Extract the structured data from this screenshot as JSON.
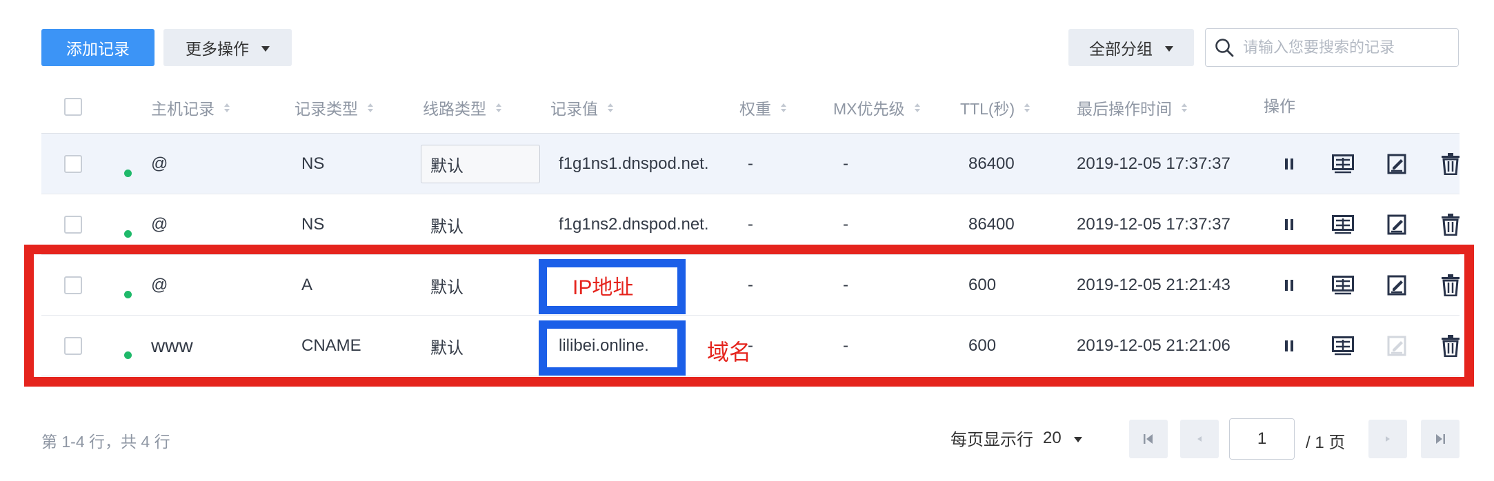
{
  "toolbar": {
    "add_label": "添加记录",
    "more_label": "更多操作",
    "group_label": "全部分组",
    "search_placeholder": "请输入您要搜索的记录"
  },
  "table": {
    "headers": {
      "host": "主机记录",
      "type": "记录类型",
      "route": "线路类型",
      "value": "记录值",
      "weight": "权重",
      "mx": "MX优先级",
      "ttl": "TTL(秒)",
      "time": "最后操作时间",
      "ops": "操作"
    },
    "rows": [
      {
        "host": "@",
        "type": "NS",
        "route": "默认",
        "value": "f1g1ns1.dnspod.net.",
        "weight": "-",
        "mx": "-",
        "ttl": "86400",
        "time": "2019-12-05 17:37:37"
      },
      {
        "host": "@",
        "type": "NS",
        "route": "默认",
        "value": "f1g1ns2.dnspod.net.",
        "weight": "-",
        "mx": "-",
        "ttl": "86400",
        "time": "2019-12-05 17:37:37"
      },
      {
        "host": "@",
        "type": "A",
        "route": "默认",
        "value": "IP地址",
        "weight": "-",
        "mx": "-",
        "ttl": "600",
        "time": "2019-12-05 21:21:43"
      },
      {
        "host": "www",
        "type": "CNAME",
        "route": "默认",
        "value": "lilibei.online.",
        "weight": "-",
        "mx": "-",
        "ttl": "600",
        "time": "2019-12-05 21:21:06"
      }
    ]
  },
  "annotations": {
    "domain_label": "域名"
  },
  "pagination": {
    "summary": "第 1-4 行，共 4 行",
    "per_page_label": "每页显示行",
    "per_page_value": "20",
    "current_page": "1",
    "total_pages": "/ 1 页"
  },
  "colors": {
    "primary": "#3c94f6",
    "status_enabled": "#1fb96a",
    "annotation_red": "#e5241d",
    "annotation_blue": "#1b5fe8"
  }
}
